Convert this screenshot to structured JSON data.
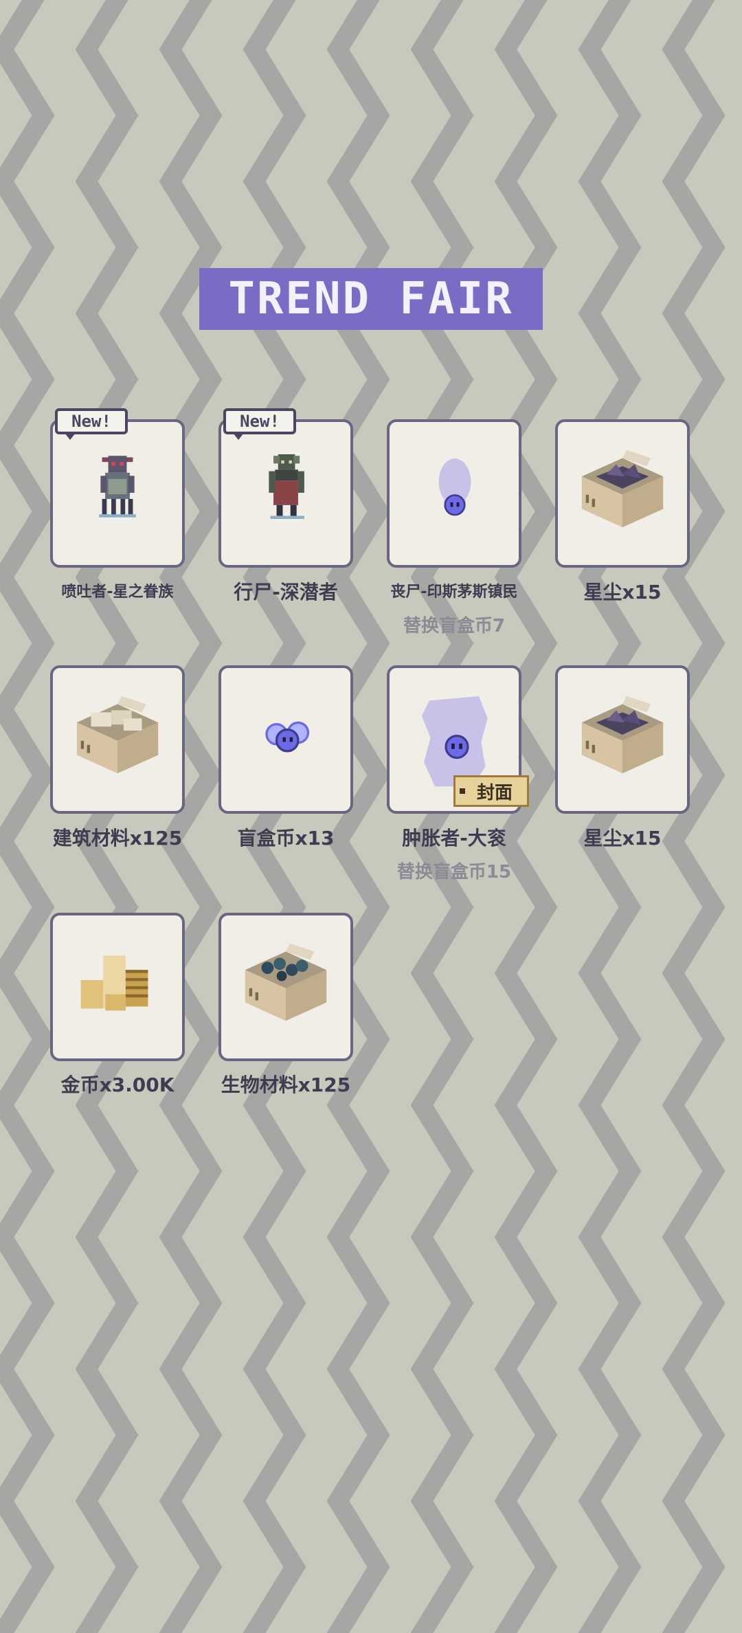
{
  "title": "TREND FAIR",
  "colors": {
    "background": "#c8c8bc",
    "zigzag": "#a4a7a3",
    "title_bg": "#7b6bc4",
    "card_bg": "#f0eee6",
    "card_border": "#6a6580"
  },
  "items": [
    {
      "label": "喷吐者-星之眷族",
      "badge": "New!",
      "icon": "tentacle-creature-sprite-icon"
    },
    {
      "label": "行尸-深潜者",
      "badge": "New!",
      "icon": "deep-one-zombie-sprite-icon"
    },
    {
      "label": "丧尸-印斯茅斯镇民",
      "sub": "替换盲盒币7",
      "icon": "locked-character-silhouette-icon"
    },
    {
      "label": "星尘x15",
      "icon": "stardust-crate-icon"
    },
    {
      "label": "建筑材料x125",
      "icon": "building-materials-crate-icon"
    },
    {
      "label": "盲盒币x13",
      "icon": "blind-box-coins-icon"
    },
    {
      "label": "肿胀者-大衮",
      "sub": "替换盲盒币15",
      "tag": "封面",
      "icon": "locked-boss-silhouette-icon"
    },
    {
      "label": "星尘x15",
      "icon": "stardust-crate-icon"
    },
    {
      "label": "金币x3.00K",
      "icon": "gold-coin-stacks-icon"
    },
    {
      "label": "生物材料x125",
      "icon": "bio-materials-crate-icon"
    }
  ]
}
